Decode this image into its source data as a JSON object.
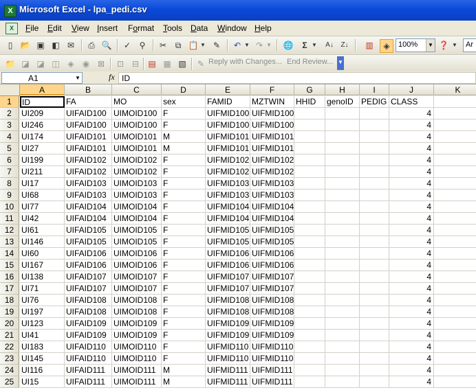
{
  "window": {
    "title": "Microsoft Excel - lpa_pedi.csv"
  },
  "menu": [
    {
      "label": "File",
      "key": "F",
      "rest": "ile"
    },
    {
      "label": "Edit",
      "key": "E",
      "rest": "dit"
    },
    {
      "label": "View",
      "key": "V",
      "rest": "iew"
    },
    {
      "label": "Insert",
      "key": "I",
      "rest": "nsert"
    },
    {
      "label": "Format",
      "key": "o",
      "pre": "F",
      "rest": "rmat"
    },
    {
      "label": "Tools",
      "key": "T",
      "rest": "ools"
    },
    {
      "label": "Data",
      "key": "D",
      "rest": "ata"
    },
    {
      "label": "Window",
      "key": "W",
      "rest": "indow"
    },
    {
      "label": "Help",
      "key": "H",
      "rest": "elp"
    }
  ],
  "toolbar": {
    "zoom": "100%",
    "font_partial": "Ar",
    "reply_label": "Reply with Changes...",
    "end_review_label": "End Review..."
  },
  "formula_bar": {
    "name_box": "A1",
    "fx": "fx",
    "content": "ID"
  },
  "columns": [
    "A",
    "B",
    "C",
    "D",
    "E",
    "F",
    "G",
    "H",
    "I",
    "J",
    "K"
  ],
  "rows": [
    [
      "ID",
      "FA",
      "MO",
      "sex",
      "FAMID",
      "MZTWIN",
      "HHID",
      "genoID",
      "PEDIG",
      "CLASS"
    ],
    [
      "UI209",
      "UIFAID100",
      "UIMOID100",
      "F",
      "UIFMID100",
      "UIFMID100",
      "",
      "",
      "",
      "4"
    ],
    [
      "UI246",
      "UIFAID100",
      "UIMOID100",
      "F",
      "UIFMID100",
      "UIFMID100",
      "",
      "",
      "",
      "4"
    ],
    [
      "UI174",
      "UIFAID101",
      "UIMOID101",
      "M",
      "UIFMID101",
      "UIFMID101",
      "",
      "",
      "",
      "4"
    ],
    [
      "UI27",
      "UIFAID101",
      "UIMOID101",
      "M",
      "UIFMID101",
      "UIFMID101",
      "",
      "",
      "",
      "4"
    ],
    [
      "UI199",
      "UIFAID102",
      "UIMOID102",
      "F",
      "UIFMID102",
      "UIFMID102",
      "",
      "",
      "",
      "4"
    ],
    [
      "UI211",
      "UIFAID102",
      "UIMOID102",
      "F",
      "UIFMID102",
      "UIFMID102",
      "",
      "",
      "",
      "4"
    ],
    [
      "UI17",
      "UIFAID103",
      "UIMOID103",
      "F",
      "UIFMID103",
      "UIFMID103",
      "",
      "",
      "",
      "4"
    ],
    [
      "UI68",
      "UIFAID103",
      "UIMOID103",
      "F",
      "UIFMID103",
      "UIFMID103",
      "",
      "",
      "",
      "4"
    ],
    [
      "UI77",
      "UIFAID104",
      "UIMOID104",
      "F",
      "UIFMID104",
      "UIFMID104",
      "",
      "",
      "",
      "4"
    ],
    [
      "UI42",
      "UIFAID104",
      "UIMOID104",
      "F",
      "UIFMID104",
      "UIFMID104",
      "",
      "",
      "",
      "4"
    ],
    [
      "UI61",
      "UIFAID105",
      "UIMOID105",
      "F",
      "UIFMID105",
      "UIFMID105",
      "",
      "",
      "",
      "4"
    ],
    [
      "UI146",
      "UIFAID105",
      "UIMOID105",
      "F",
      "UIFMID105",
      "UIFMID105",
      "",
      "",
      "",
      "4"
    ],
    [
      "UI60",
      "UIFAID106",
      "UIMOID106",
      "F",
      "UIFMID106",
      "UIFMID106",
      "",
      "",
      "",
      "4"
    ],
    [
      "UI167",
      "UIFAID106",
      "UIMOID106",
      "F",
      "UIFMID106",
      "UIFMID106",
      "",
      "",
      "",
      "4"
    ],
    [
      "UI138",
      "UIFAID107",
      "UIMOID107",
      "F",
      "UIFMID107",
      "UIFMID107",
      "",
      "",
      "",
      "4"
    ],
    [
      "UI71",
      "UIFAID107",
      "UIMOID107",
      "F",
      "UIFMID107",
      "UIFMID107",
      "",
      "",
      "",
      "4"
    ],
    [
      "UI76",
      "UIFAID108",
      "UIMOID108",
      "F",
      "UIFMID108",
      "UIFMID108",
      "",
      "",
      "",
      "4"
    ],
    [
      "UI197",
      "UIFAID108",
      "UIMOID108",
      "F",
      "UIFMID108",
      "UIFMID108",
      "",
      "",
      "",
      "4"
    ],
    [
      "UI123",
      "UIFAID109",
      "UIMOID109",
      "F",
      "UIFMID109",
      "UIFMID109",
      "",
      "",
      "",
      "4"
    ],
    [
      "UI41",
      "UIFAID109",
      "UIMOID109",
      "F",
      "UIFMID109",
      "UIFMID109",
      "",
      "",
      "",
      "4"
    ],
    [
      "UI183",
      "UIFAID110",
      "UIMOID110",
      "F",
      "UIFMID110",
      "UIFMID110",
      "",
      "",
      "",
      "4"
    ],
    [
      "UI145",
      "UIFAID110",
      "UIMOID110",
      "F",
      "UIFMID110",
      "UIFMID110",
      "",
      "",
      "",
      "4"
    ],
    [
      "UI116",
      "UIFAID111",
      "UIMOID111",
      "M",
      "UIFMID111",
      "UIFMID111",
      "",
      "",
      "",
      "4"
    ],
    [
      "UI15",
      "UIFAID111",
      "UIMOID111",
      "M",
      "UIFMID111",
      "UIFMID111",
      "",
      "",
      "",
      "4"
    ]
  ]
}
